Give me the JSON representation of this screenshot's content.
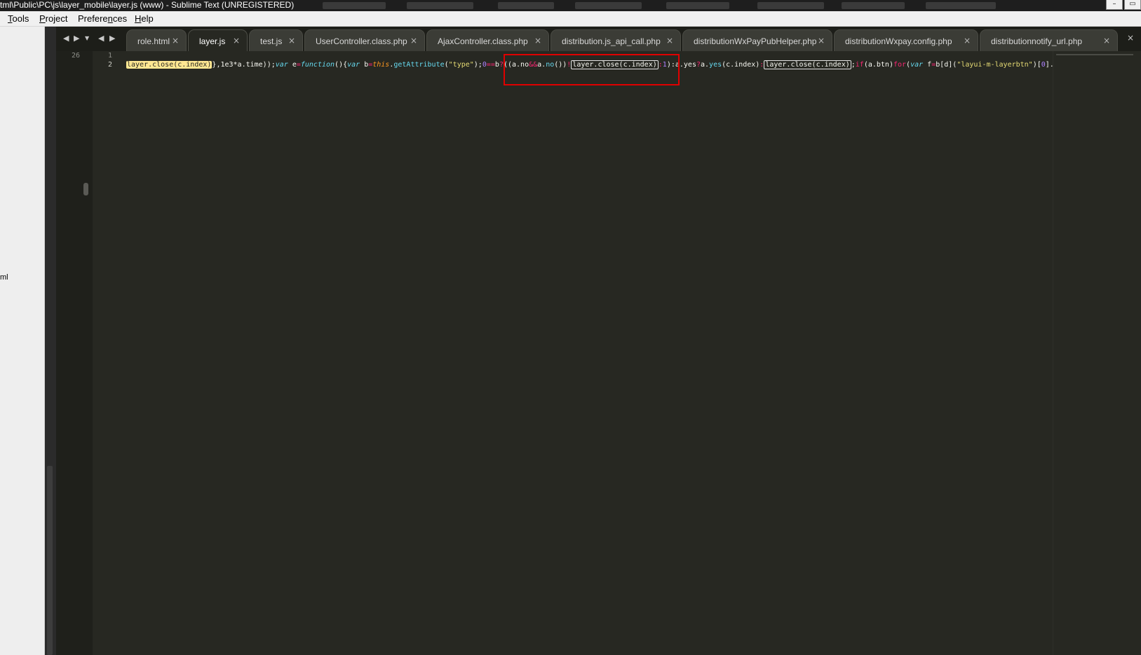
{
  "window": {
    "title": "tml\\Public\\PC\\js\\layer_mobile\\layer.js (www) - Sublime Text (UNREGISTERED)",
    "controls": {
      "minimize": "–",
      "maximize": "▭"
    }
  },
  "menu": {
    "items": [
      {
        "key": "T",
        "rest": "ools"
      },
      {
        "key": "P",
        "rest": "roject"
      },
      {
        "key": "Prefere",
        "keyU": "n",
        "rest": "ces"
      },
      {
        "key": "H",
        "rest": "elp"
      }
    ]
  },
  "sidebar": {
    "partial_label": "ml"
  },
  "tab_nav": {
    "back": "◀",
    "forward": "▶",
    "menu": "▼",
    "prev": "◀",
    "next": "▶"
  },
  "tabs": [
    {
      "label": "role.html",
      "close": "×"
    },
    {
      "label": "layer.js",
      "close": "×",
      "active": true
    },
    {
      "label": "test.js",
      "close": "×"
    },
    {
      "label": "UserController.class.php",
      "close": "×"
    },
    {
      "label": "AjaxController.class.php",
      "close": "×"
    },
    {
      "label": "distribution.js_api_call.php",
      "close": "×"
    },
    {
      "label": "distributionWxPayPubHelper.php",
      "close": "×"
    },
    {
      "label": "distributionWxpay.config.php",
      "close": "×"
    },
    {
      "label": "distributionnotify_url.php",
      "close": "×"
    }
  ],
  "tab_overflow_close": "×",
  "editor": {
    "gutter_left_number": "26",
    "line_numbers": [
      "1",
      "2"
    ],
    "code": {
      "t01": "layer.close(c.index)",
      "t02": "},1e3*a.time));",
      "t03": "var",
      "t04": " e",
      "t05": "=",
      "t06": "function",
      "t07": "(){",
      "t08": "var",
      "t09": " b",
      "t10": "=",
      "t11": "this",
      "t12": ".",
      "t13": "getAttribute",
      "t14": "(",
      "t15": "\"type\"",
      "t16": ");",
      "t17": "0",
      "t18": "==",
      "t19": "b",
      "t20": "?",
      "t21": "((a.no",
      "t22": "&&",
      "t23": "a.",
      "t24": "no",
      "t25": "())",
      "t26": "!",
      "t27": "layer.close(c.index)",
      "t28": ":",
      "t29": "1",
      "t30": "):",
      "t31": "a.yes",
      "t32": "?",
      "t33": "a.",
      "t34": "yes",
      "t35": "(c.index)",
      "t36": ":",
      "t37": "layer.close(c.index)",
      "t38": ";",
      "t39": "if",
      "t40": "(a.btn)",
      "t41": "for",
      "t42": "(",
      "t43": "var",
      "t44": " f",
      "t45": "=",
      "t46": "b[d](",
      "t47": "\"layui-m-layerbtn\"",
      "t48": ")[",
      "t49": "0",
      "t50": "].c"
    }
  },
  "colors": {
    "editor_bg": "#272822",
    "annotation": "#e00000",
    "find_highlight": "#ffe792"
  }
}
